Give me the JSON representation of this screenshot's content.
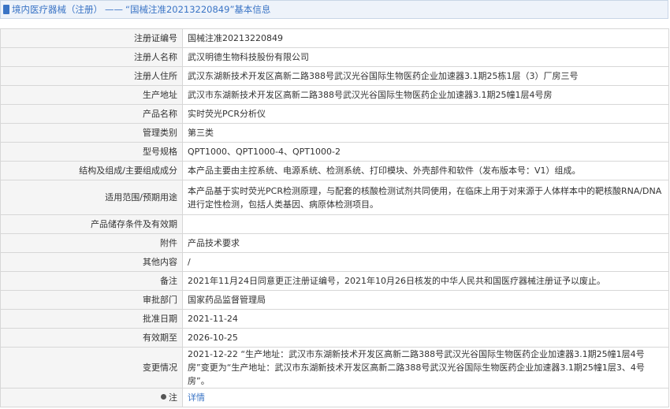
{
  "header": {
    "section": "境内医疗器械（注册）",
    "separator": "——",
    "record_title": "“国械注准20213220849”基本信息"
  },
  "rows": [
    {
      "label": "注册证编号",
      "value": "国械注准20213220849"
    },
    {
      "label": "注册人名称",
      "value": "武汉明德生物科技股份有限公司"
    },
    {
      "label": "注册人住所",
      "value": "武汉东湖新技术开发区高新二路388号武汉光谷国际生物医药企业加速器3.1期25栋1层（3）厂房三号"
    },
    {
      "label": "生产地址",
      "value": "武汉市东湖新技术开发区高新二路388号武汉光谷国际生物医药企业加速器3.1期25幢1层4号房"
    },
    {
      "label": "产品名称",
      "value": "实时荧光PCR分析仪"
    },
    {
      "label": "管理类别",
      "value": "第三类"
    },
    {
      "label": "型号规格",
      "value": "QPT1000、QPT1000-4、QPT1000-2"
    },
    {
      "label": "结构及组成/主要组成成分",
      "value": "本产品主要由主控系统、电源系统、检测系统、打印模块、外壳部件和软件（发布版本号：V1）组成。"
    },
    {
      "label": "适用范围/预期用途",
      "value": "本产品基于实时荧光PCR检测原理，与配套的核酸检测试剂共同使用，在临床上用于对来源于人体样本中的靶核酸RNA/DNA进行定性检测，包括人类基因、病原体检测项目。"
    },
    {
      "label": "产品储存条件及有效期",
      "value": ""
    },
    {
      "label": "附件",
      "value": "产品技术要求"
    },
    {
      "label": "其他内容",
      "value": "/"
    },
    {
      "label": "备注",
      "value": "2021年11月24日同意更正注册证编号，2021年10月26日核发的中华人民共和国医疗器械注册证予以废止。"
    },
    {
      "label": "审批部门",
      "value": "国家药品监督管理局"
    },
    {
      "label": "批准日期",
      "value": "2021-11-24"
    },
    {
      "label": "有效期至",
      "value": "2026-10-25"
    },
    {
      "label": "变更情况",
      "value": "2021-12-22 “生产地址：武汉市东湖新技术开发区高新二路388号武汉光谷国际生物医药企业加速器3.1期25幢1层4号房”变更为“生产地址：武汉市东湖新技术开发区高新二路388号武汉光谷国际生物医药企业加速器3.1期25幢1层3、4号房”。"
    }
  ],
  "footer": {
    "label": "注",
    "link": "详情"
  }
}
